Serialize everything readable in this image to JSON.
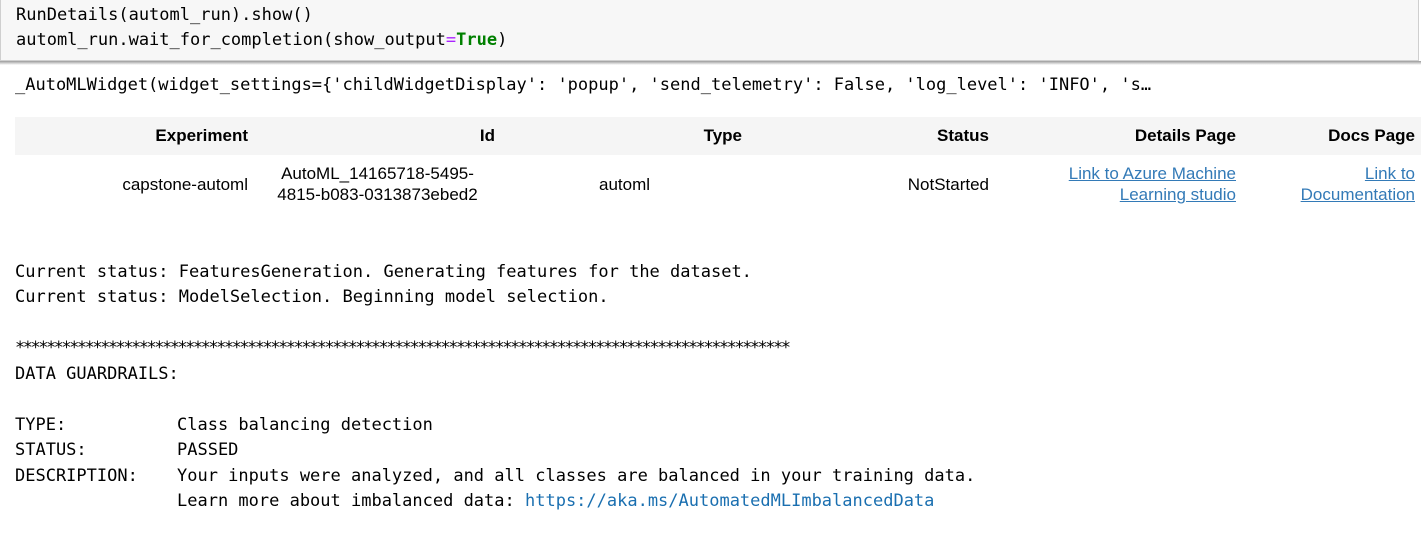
{
  "input_cell": {
    "line1": "RunDetails(automl_run).show()",
    "line2_prefix": "automl_run.wait_for_completion(show_output",
    "line2_eq": "=",
    "line2_kw": "True",
    "line2_suffix": ")"
  },
  "widget_repr": "_AutoMLWidget(widget_settings={'childWidgetDisplay': 'popup', 'send_telemetry': False, 'log_level': 'INFO', 's…",
  "run_table": {
    "headers": {
      "experiment": "Experiment",
      "id": "Id",
      "type": "Type",
      "status": "Status",
      "details": "Details Page",
      "docs": "Docs Page"
    },
    "row": {
      "experiment": "capstone-automl",
      "id_line1": "AutoML_14165718-5495-",
      "id_line2": "4815-b083-0313873ebed2",
      "type": "automl",
      "status": "NotStarted",
      "details_line1": "Link to Azure Machine",
      "details_line2": "Learning studio",
      "docs": "Link to Documentation"
    }
  },
  "output": {
    "status1": "Current status: FeaturesGeneration. Generating features for the dataset.",
    "status2": "Current status: ModelSelection. Beginning model selection.",
    "separator": "****************************************************************************************************",
    "guardrails_title": "DATA GUARDRAILS:",
    "type_label": "TYPE:",
    "type_value": "Class balancing detection",
    "status_label": "STATUS:",
    "status_value": "PASSED",
    "desc_label": "DESCRIPTION:",
    "desc_value": "Your inputs were analyzed, and all classes are balanced in your training data.",
    "learn_more_text": "Learn more about imbalanced data: ",
    "learn_more_link": "https://aka.ms/AutomatedMLImbalancedData"
  },
  "colors": {
    "keyword_green": "#008000",
    "operator_purple": "#aa22ff",
    "link_blue": "#337ab7",
    "cell_bg": "#f7f7f7",
    "table_header_bg": "#f5f5f5"
  }
}
